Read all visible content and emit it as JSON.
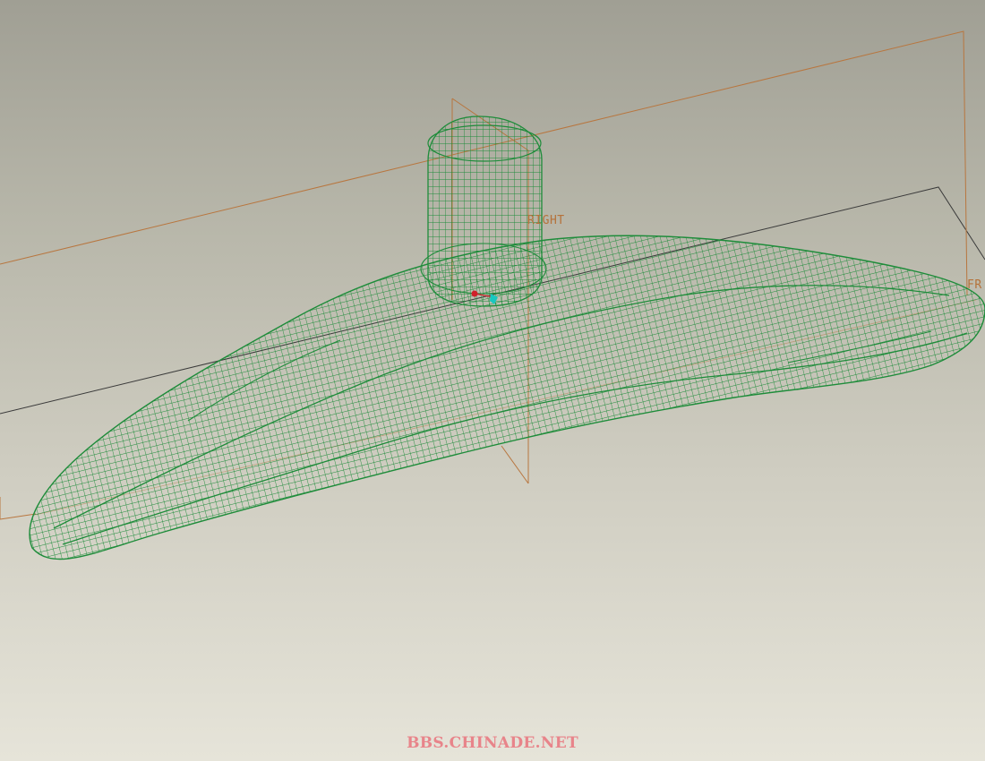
{
  "viewport": {
    "background_top": "#a09f94",
    "background_bottom": "#e6e4d9"
  },
  "model": {
    "mesh_color": "#1e8c3a",
    "display_mode": "wireframe"
  },
  "datum_planes": {
    "color": "#b8763f",
    "right_label": "RIGHT",
    "front_label": "FR"
  },
  "reference_plane": {
    "color": "#3a3a3a"
  },
  "coordinate_system": {
    "x_axis_color": "#d0202a",
    "y_axis_color": "#18c8c0"
  },
  "watermark": {
    "text": "BBS.CHINADE.NET",
    "color": "#e8848a"
  }
}
